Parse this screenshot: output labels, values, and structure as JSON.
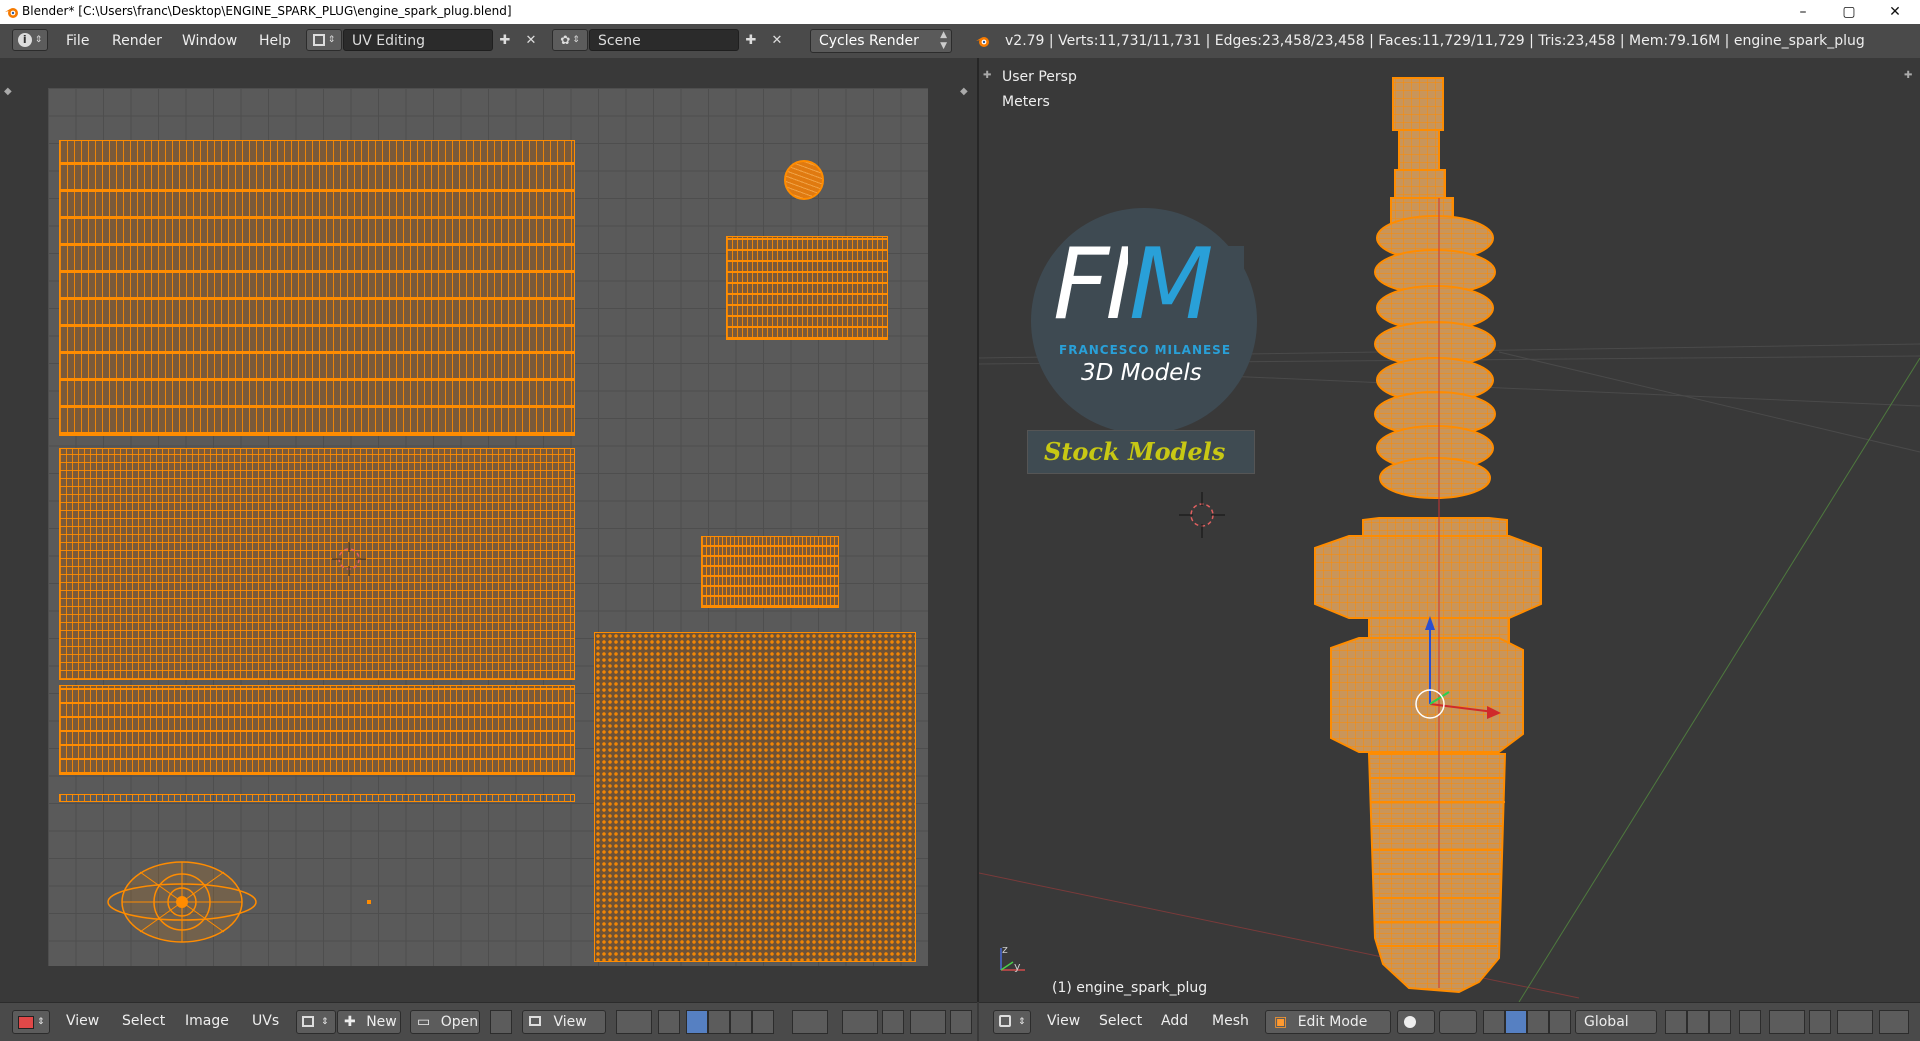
{
  "window": {
    "title": "Blender* [C:\\Users\\franc\\Desktop\\ENGINE_SPARK_PLUG\\engine_spark_plug.blend]",
    "controls": {
      "minimize": "–",
      "maximize": "▢",
      "close": "✕"
    }
  },
  "topbar": {
    "menus": [
      "File",
      "Render",
      "Window",
      "Help"
    ],
    "screen_layout": "UV Editing",
    "scene": "Scene",
    "render_engine": "Cycles Render",
    "stats": "v2.79 | Verts:11,731/11,731 | Edges:23,458/23,458 | Faces:11,729/11,729 | Tris:23,458 | Mem:79.16M | engine_spark_plug"
  },
  "uv_editor": {
    "menus": [
      "View",
      "Select",
      "Image",
      "UVs"
    ],
    "new_label": "New",
    "open_label": "Open",
    "view_label": "View"
  },
  "viewport": {
    "view_name": "User Persp",
    "units": "Meters",
    "object_label": "(1) engine_spark_plug",
    "menus": [
      "View",
      "Select",
      "Add",
      "Mesh"
    ],
    "mode": "Edit Mode",
    "orientation": "Global",
    "watermark": {
      "monogram": "FM",
      "author": "FRANCESCO MILANESE",
      "subtitle": "3D Models",
      "tag": "Stock Models"
    },
    "axis_labels": {
      "z": "z",
      "y": "y"
    }
  },
  "colors": {
    "uv_orange": "#ff8c00",
    "mesh_fill": "#c9955a",
    "accent_blue": "#29a0d8",
    "stock_yellow": "#c8c814"
  }
}
